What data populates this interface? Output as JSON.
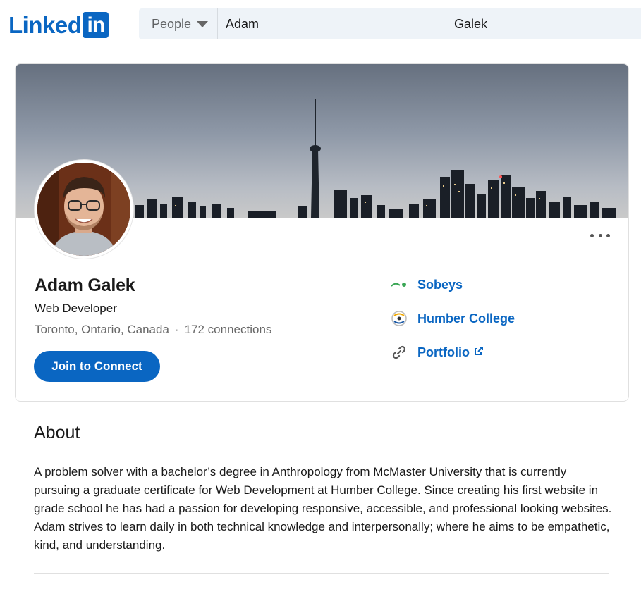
{
  "brand": {
    "logo_word": "Linked",
    "logo_box": "in",
    "color": "#0a66c2"
  },
  "search": {
    "type_label": "People",
    "first_name_value": "Adam",
    "last_name_value": "Galek"
  },
  "profile": {
    "name": "Adam Galek",
    "headline": "Web Developer",
    "location": "Toronto, Ontario, Canada",
    "separator": "·",
    "connections": "172 connections",
    "join_button": "Join to Connect",
    "more_icon": "more-horizontal-icon"
  },
  "links": [
    {
      "label": "Sobeys",
      "icon": "sobeys-logo-icon",
      "external": false
    },
    {
      "label": "Humber College",
      "icon": "humber-logo-icon",
      "external": false
    },
    {
      "label": "Portfolio",
      "icon": "link-icon",
      "external": true
    }
  ],
  "about": {
    "title": "About",
    "text": "A problem solver with a bachelor’s degree in Anthropology from McMaster University that is currently pursuing a graduate certificate for Web Development at Humber College. Since creating his first website in grade school he has had a passion for developing responsive, accessible, and professional looking websites. Adam strives to learn daily in both technical knowledge and interpersonally; where he aims to be empathetic, kind, and understanding."
  },
  "colors": {
    "accent": "#0a66c2",
    "search_bg": "#eef3f8",
    "muted_text": "#666666"
  }
}
